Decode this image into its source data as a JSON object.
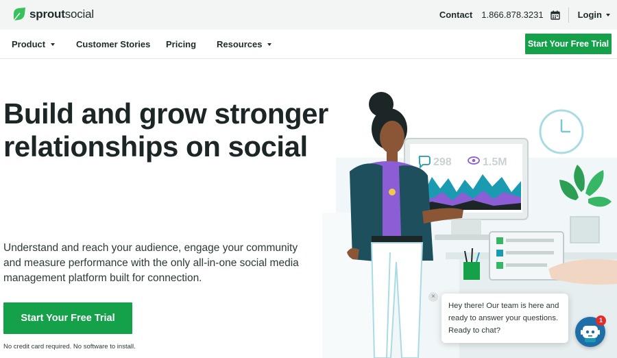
{
  "brand": {
    "logo_bold": "sprout",
    "logo_light": "social",
    "green": "#15a04a",
    "dark": "#1c2626"
  },
  "topbar": {
    "contact_label": "Contact",
    "phone": "1.866.878.3231",
    "calendar_icon": "calendar-icon",
    "login_label": "Login"
  },
  "nav": {
    "items": [
      {
        "label": "Product",
        "has_caret": true
      },
      {
        "label": "Customer Stories",
        "has_caret": false
      },
      {
        "label": "Pricing",
        "has_caret": false
      },
      {
        "label": "Resources",
        "has_caret": true
      }
    ],
    "cta_label": "Start Your Free Trial"
  },
  "hero": {
    "headline": "Build and grow stronger relationships on social",
    "subcopy": "Understand and reach your audience, engage your community and measure performance with the only all-in-one social media management platform built for connection.",
    "cta_label": "Start Your Free Trial",
    "disclaimer": "No credit card required. No software to install."
  },
  "illustration": {
    "comments_count": "298",
    "views_count": "1.5M"
  },
  "chat": {
    "close_glyph": "×",
    "message": "Hey there! Our team is here and ready to answer your questions. Ready to chat?",
    "badge_count": "1"
  }
}
